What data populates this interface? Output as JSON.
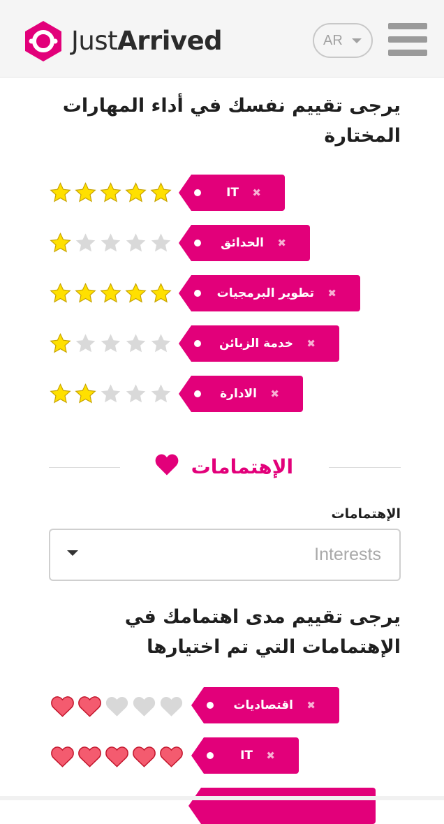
{
  "header": {
    "logo_text_regular": "Just",
    "logo_text_bold": "Arrived",
    "language": "AR"
  },
  "skills": {
    "heading": "يرجى تقييم نفسك في أداء المهارات المختارة",
    "max_rating": 5,
    "items": [
      {
        "label": "IT",
        "rating": 5
      },
      {
        "label": "الحدائق",
        "rating": 1
      },
      {
        "label": "تطوير البرمجيات",
        "rating": 5
      },
      {
        "label": "خدمة الزبائن",
        "rating": 1
      },
      {
        "label": "الادارة",
        "rating": 2
      }
    ]
  },
  "interests": {
    "section_title": "الإهتمامات",
    "field_label": "الإهتمامات",
    "select_placeholder": "Interests",
    "heading": "يرجى تقييم مدى اهتمامك في الإهتمامات التي تم اختيارها",
    "max_rating": 5,
    "items": [
      {
        "label": "اقتصاديات",
        "rating": 2
      },
      {
        "label": "IT",
        "rating": 5
      }
    ]
  },
  "colors": {
    "brand_pink": "#e2007a",
    "star_filled": "#ffe000",
    "star_empty": "#d9d9d9",
    "heart_filled": "#f45b6f",
    "heart_empty": "#d8d8d8"
  }
}
